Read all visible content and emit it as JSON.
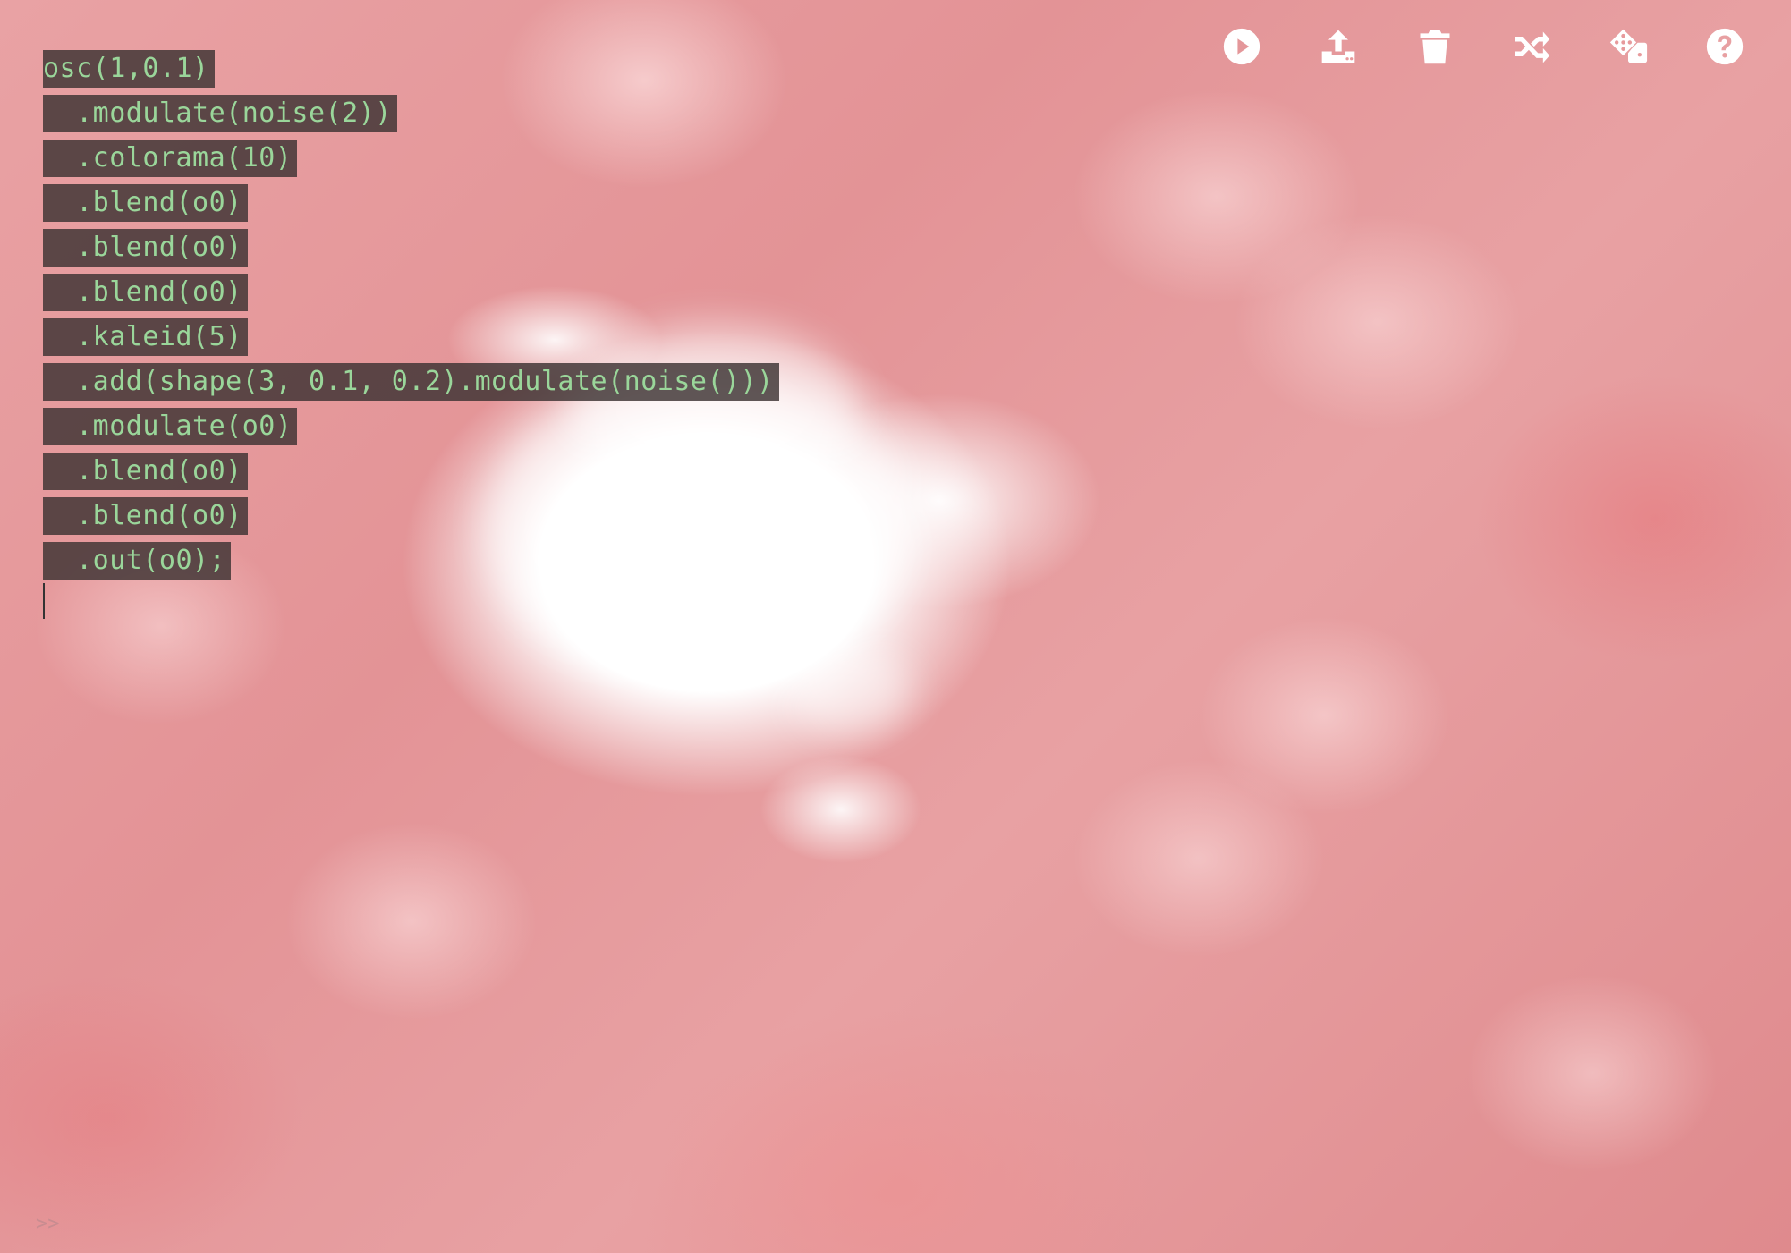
{
  "app": {
    "canvas_label": "hydra output canvas"
  },
  "editor": {
    "lines": [
      "osc(1,0.1)",
      "  .modulate(noise(2))",
      "  .colorama(10)",
      "  .blend(o0)",
      "  .blend(o0)",
      "  .blend(o0)",
      "  .kaleid(5)",
      "  .add(shape(3, 0.1, 0.2).modulate(noise()))",
      "  .modulate(o0)",
      "  .blend(o0)",
      "  .blend(o0)",
      "  .out(o0);"
    ]
  },
  "toolbar": {
    "buttons": [
      {
        "name": "run",
        "icon": "play-circle-icon"
      },
      {
        "name": "upload",
        "icon": "upload-icon"
      },
      {
        "name": "clear",
        "icon": "trash-icon"
      },
      {
        "name": "shuffle",
        "icon": "shuffle-icon"
      },
      {
        "name": "random",
        "icon": "dice-icon"
      },
      {
        "name": "help",
        "icon": "help-circle-icon"
      }
    ]
  },
  "console": {
    "prompt": ">>"
  },
  "colors": {
    "code_fg": "#9ad69a",
    "code_bg": "#3c3232",
    "canvas_pink": "#e79a9c",
    "icon_fg": "#ffffff"
  }
}
